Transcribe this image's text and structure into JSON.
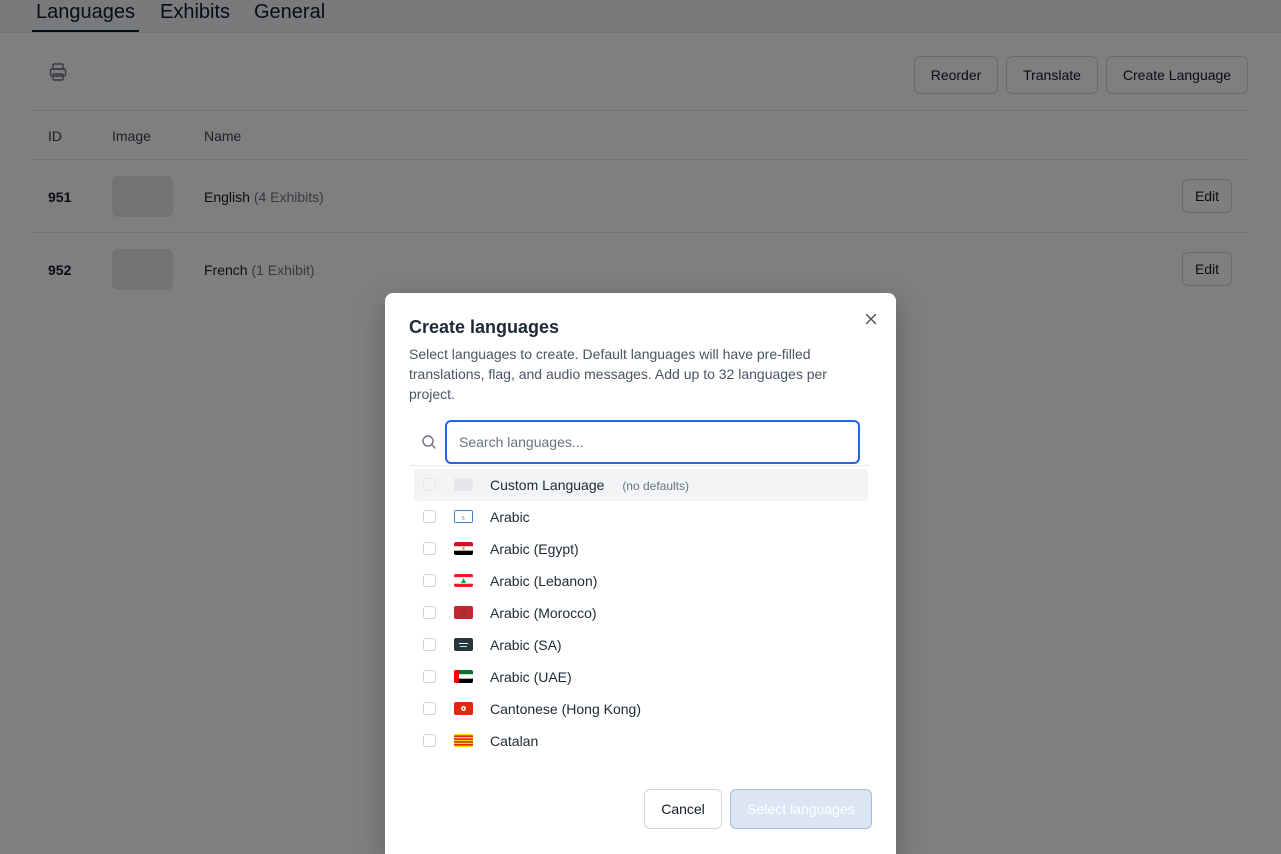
{
  "tabs": [
    {
      "label": "Languages",
      "active": true
    },
    {
      "label": "Exhibits",
      "active": false
    },
    {
      "label": "General",
      "active": false
    }
  ],
  "toolbar": {
    "print_icon": "printer-icon",
    "reorder_label": "Reorder",
    "translate_label": "Translate",
    "create_label": "Create Language"
  },
  "table": {
    "headers": {
      "id": "ID",
      "image": "Image",
      "name": "Name"
    },
    "rows": [
      {
        "id": "951",
        "name": "English",
        "count": "(4 Exhibits)",
        "edit": "Edit"
      },
      {
        "id": "952",
        "name": "French",
        "count": "(1 Exhibit)",
        "edit": "Edit"
      }
    ]
  },
  "modal": {
    "title": "Create languages",
    "description": "Select languages to create. Default languages will have pre-filled translations, flag, and audio messages. Add up to 32 languages per project.",
    "search_placeholder": "Search languages...",
    "search_value": "",
    "custom": {
      "label": "Custom Language",
      "note": "(no defaults)"
    },
    "languages": [
      {
        "label": "Arabic",
        "flag": "arabic-flag"
      },
      {
        "label": "Arabic (Egypt)",
        "flag": "egypt-flag"
      },
      {
        "label": "Arabic (Lebanon)",
        "flag": "lebanon-flag"
      },
      {
        "label": "Arabic (Morocco)",
        "flag": "morocco-flag"
      },
      {
        "label": "Arabic (SA)",
        "flag": "saudi-arabia-flag"
      },
      {
        "label": "Arabic (UAE)",
        "flag": "uae-flag"
      },
      {
        "label": "Cantonese (Hong Kong)",
        "flag": "hong-kong-flag"
      },
      {
        "label": "Catalan",
        "flag": "catalonia-flag"
      }
    ],
    "cancel_label": "Cancel",
    "submit_label": "Select languages"
  },
  "colors": {
    "overlay": "#808080",
    "accent": "#2563eb",
    "submit_disabled": "#dbe5f4"
  }
}
